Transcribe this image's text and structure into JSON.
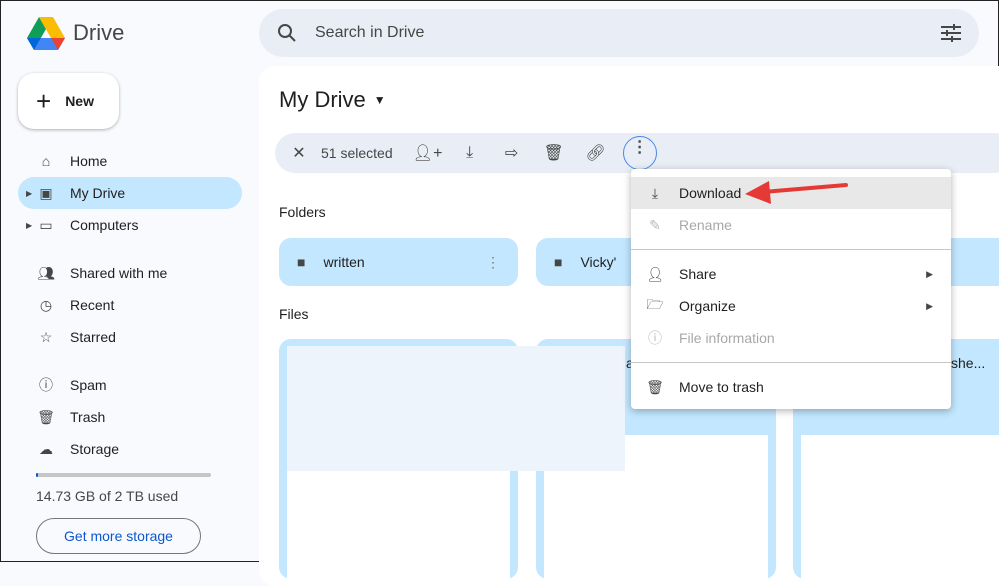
{
  "app": {
    "name": "Drive"
  },
  "search": {
    "placeholder": "Search in Drive"
  },
  "new_label": "New",
  "sidebar": {
    "items": [
      {
        "label": "Home",
        "icon": "home-icon"
      },
      {
        "label": "My Drive",
        "icon": "my-drive-icon"
      },
      {
        "label": "Computers",
        "icon": "computer-icon"
      },
      {
        "label": "Shared with me",
        "icon": "people-icon"
      },
      {
        "label": "Recent",
        "icon": "clock-icon"
      },
      {
        "label": "Starred",
        "icon": "star-icon"
      },
      {
        "label": "Spam",
        "icon": "spam-icon"
      },
      {
        "label": "Trash",
        "icon": "trash-icon"
      },
      {
        "label": "Storage",
        "icon": "cloud-icon"
      }
    ]
  },
  "storage": {
    "used_text": "14.73 GB of 2 TB used",
    "used_fraction": 0.007,
    "button": "Get more storage"
  },
  "main": {
    "title": "My Drive",
    "selected": "51 selected",
    "folders_label": "Folders",
    "files_label": "Files",
    "folders": [
      "written",
      "Vicky'"
    ],
    "files": [
      "a",
      "she..."
    ]
  },
  "menu": {
    "items": [
      "Download",
      "Rename",
      "Share",
      "Organize",
      "File information",
      "Move to trash"
    ]
  },
  "colors": {
    "accent": "#0b57d0",
    "selected": "#c2e7ff",
    "arrow": "#e53935"
  }
}
